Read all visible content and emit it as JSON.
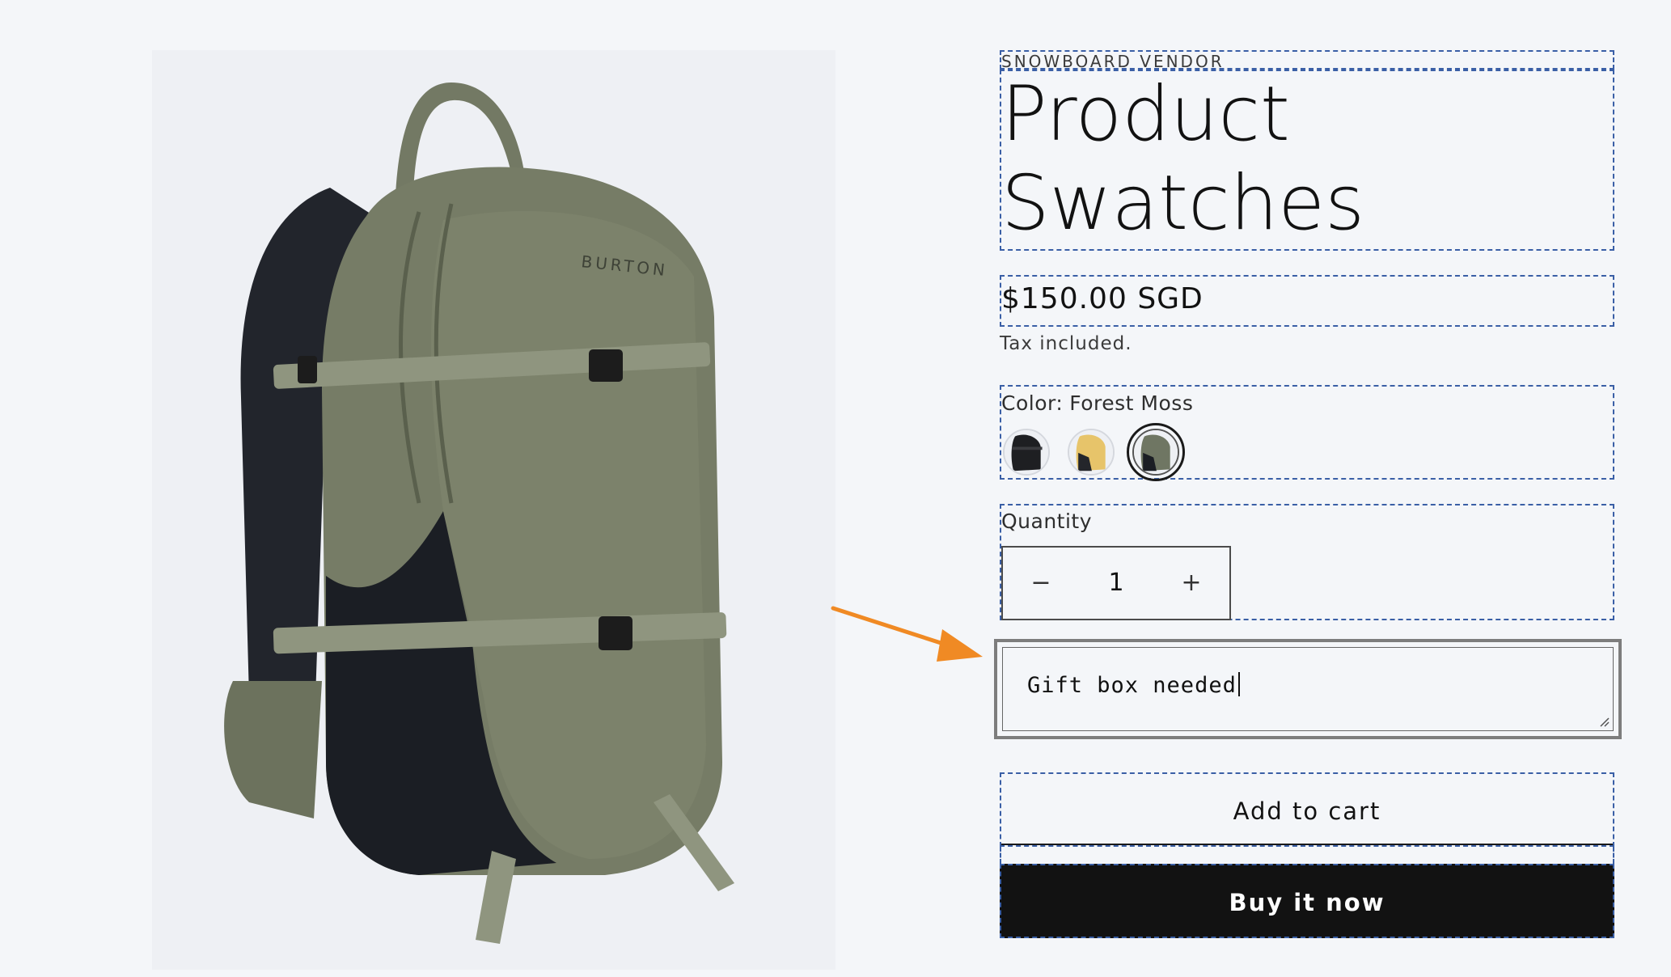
{
  "product": {
    "vendor": "SNOWBOARD VENDOR",
    "title_line1": "Product",
    "title_line2": "Swatches",
    "price": "$150.00 SGD",
    "tax_note": "Tax included.",
    "image_brand_text": "BURTON"
  },
  "color": {
    "label": "Color:",
    "selected": "Forest Moss",
    "swatches": [
      {
        "name": "Black",
        "hex": "#1e1f22",
        "selected": false
      },
      {
        "name": "Yellow",
        "hex": "#e7c46a",
        "selected": false
      },
      {
        "name": "Forest Moss",
        "hex": "#6f7663",
        "selected": true
      }
    ]
  },
  "quantity": {
    "label": "Quantity",
    "value": "1",
    "minus": "−",
    "plus": "+"
  },
  "note": {
    "value": "Gift box needed"
  },
  "buttons": {
    "add_to_cart": "Add to cart",
    "buy_now": "Buy it now"
  },
  "colors": {
    "accent_arrow": "#f08a24",
    "dash_outline": "#3a5fa6",
    "backpack_green": "#747a64",
    "backpack_black": "#1b1e24"
  }
}
